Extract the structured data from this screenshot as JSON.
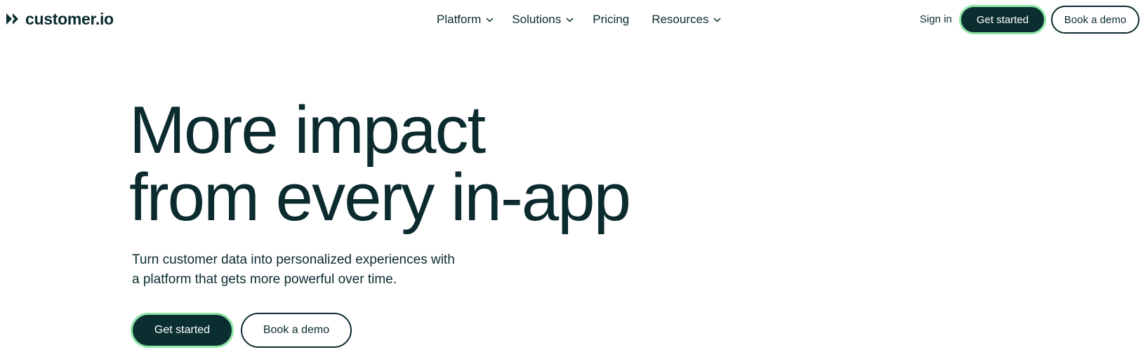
{
  "brand": {
    "name": "customer.io",
    "logo_icon": "double-chevron-logo",
    "color_dark": "#0b2f30",
    "color_accent": "#8fe6a6"
  },
  "nav": {
    "items": [
      {
        "label": "Platform",
        "has_dropdown": true
      },
      {
        "label": "Solutions",
        "has_dropdown": true
      },
      {
        "label": "Pricing",
        "has_dropdown": false
      },
      {
        "label": "Resources",
        "has_dropdown": true
      }
    ],
    "sign_in": "Sign in",
    "get_started": "Get started",
    "book_demo": "Book a demo"
  },
  "hero": {
    "title_line1": "More impact",
    "title_line2": "from every in-app",
    "subtitle_line1": "Turn customer data into personalized experiences with",
    "subtitle_line2": "a platform that gets more powerful over time.",
    "primary_cta": "Get started",
    "secondary_cta": "Book a demo"
  }
}
